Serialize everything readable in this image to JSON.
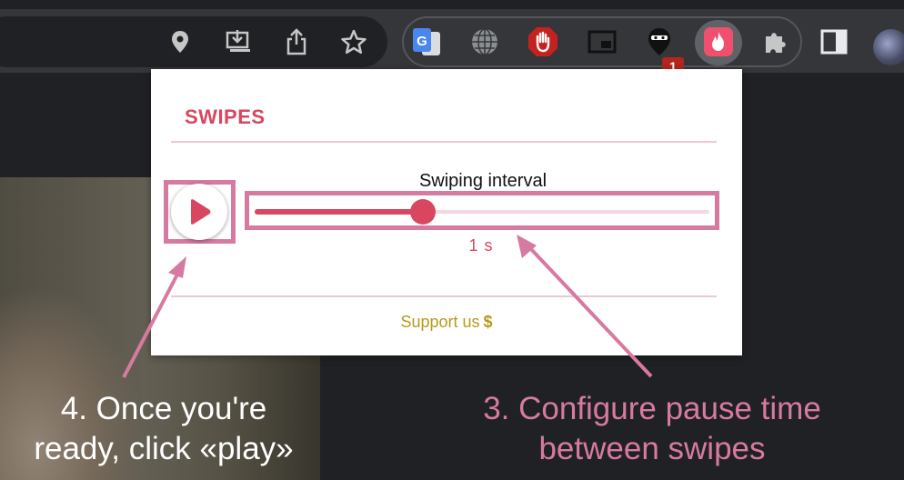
{
  "toolbar": {
    "address_bar_icons": [
      "location-pin-icon",
      "install-app-icon",
      "share-icon",
      "bookmark-star-icon"
    ],
    "extension_icons": [
      "google-translate-icon",
      "globe-icon",
      "stop-hand-icon",
      "picture-in-picture-icon",
      "ninja-icon",
      "tinder-flame-icon",
      "extensions-puzzle-icon"
    ],
    "ninja_badge": "1",
    "side_panel_icon": "side-panel-icon",
    "profile_icon": "profile-avatar"
  },
  "popup": {
    "title": "SWIPES",
    "interval_label": "Swiping interval",
    "interval_value": "1 s",
    "slider_level": 0.37,
    "support_label": "Support us",
    "support_symbol": "$",
    "accent_color": "#d9465f",
    "support_color": "#b7991e"
  },
  "annotations": {
    "left_caption": [
      "4. Once you're",
      "ready, click «play»"
    ],
    "right_caption": [
      "3. Configure pause time",
      "between swipes"
    ],
    "highlight_color": "#d77aa1"
  }
}
